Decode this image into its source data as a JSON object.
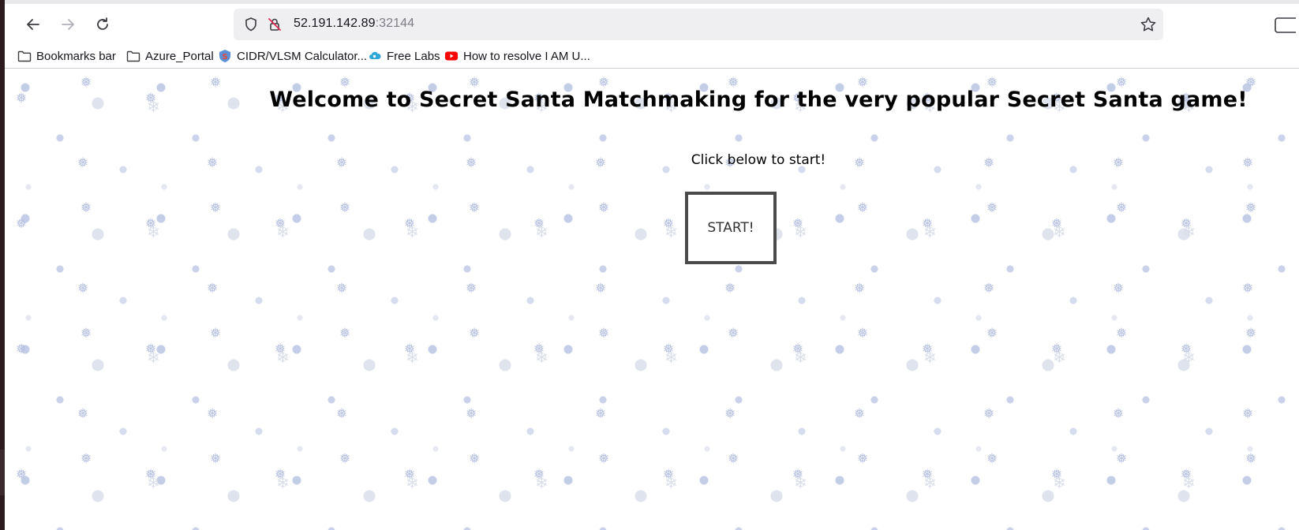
{
  "browser": {
    "url_host": "52.191.142.89",
    "url_port": ":32144",
    "icons": {
      "back": "arrow-left-icon",
      "forward": "arrow-right-icon",
      "reload": "reload-icon",
      "shield": "shield-icon",
      "insecure": "insecure-lock-icon",
      "bookmark_star": "star-icon"
    }
  },
  "bookmarks_bar": {
    "items": [
      {
        "label": "Bookmarks bar",
        "icon": "folder-icon"
      },
      {
        "label": "Azure_Portal",
        "icon": "folder-icon"
      },
      {
        "label": "CIDR/VLSM Calculator...",
        "icon": "subnet-favicon-icon"
      },
      {
        "label": "Free Labs",
        "icon": "cloud-favicon-icon"
      },
      {
        "label": "How to resolve I AM U...",
        "icon": "youtube-favicon-icon"
      }
    ]
  },
  "page": {
    "heading": "Welcome to Secret Santa Matchmaking for the very popular Secret Santa game!",
    "subheading": "Click below to start!",
    "start_button": "START!"
  },
  "colors": {
    "snowflake": "#b9c3e2",
    "button_border": "#4a4a4a",
    "background": "#ffffff"
  }
}
